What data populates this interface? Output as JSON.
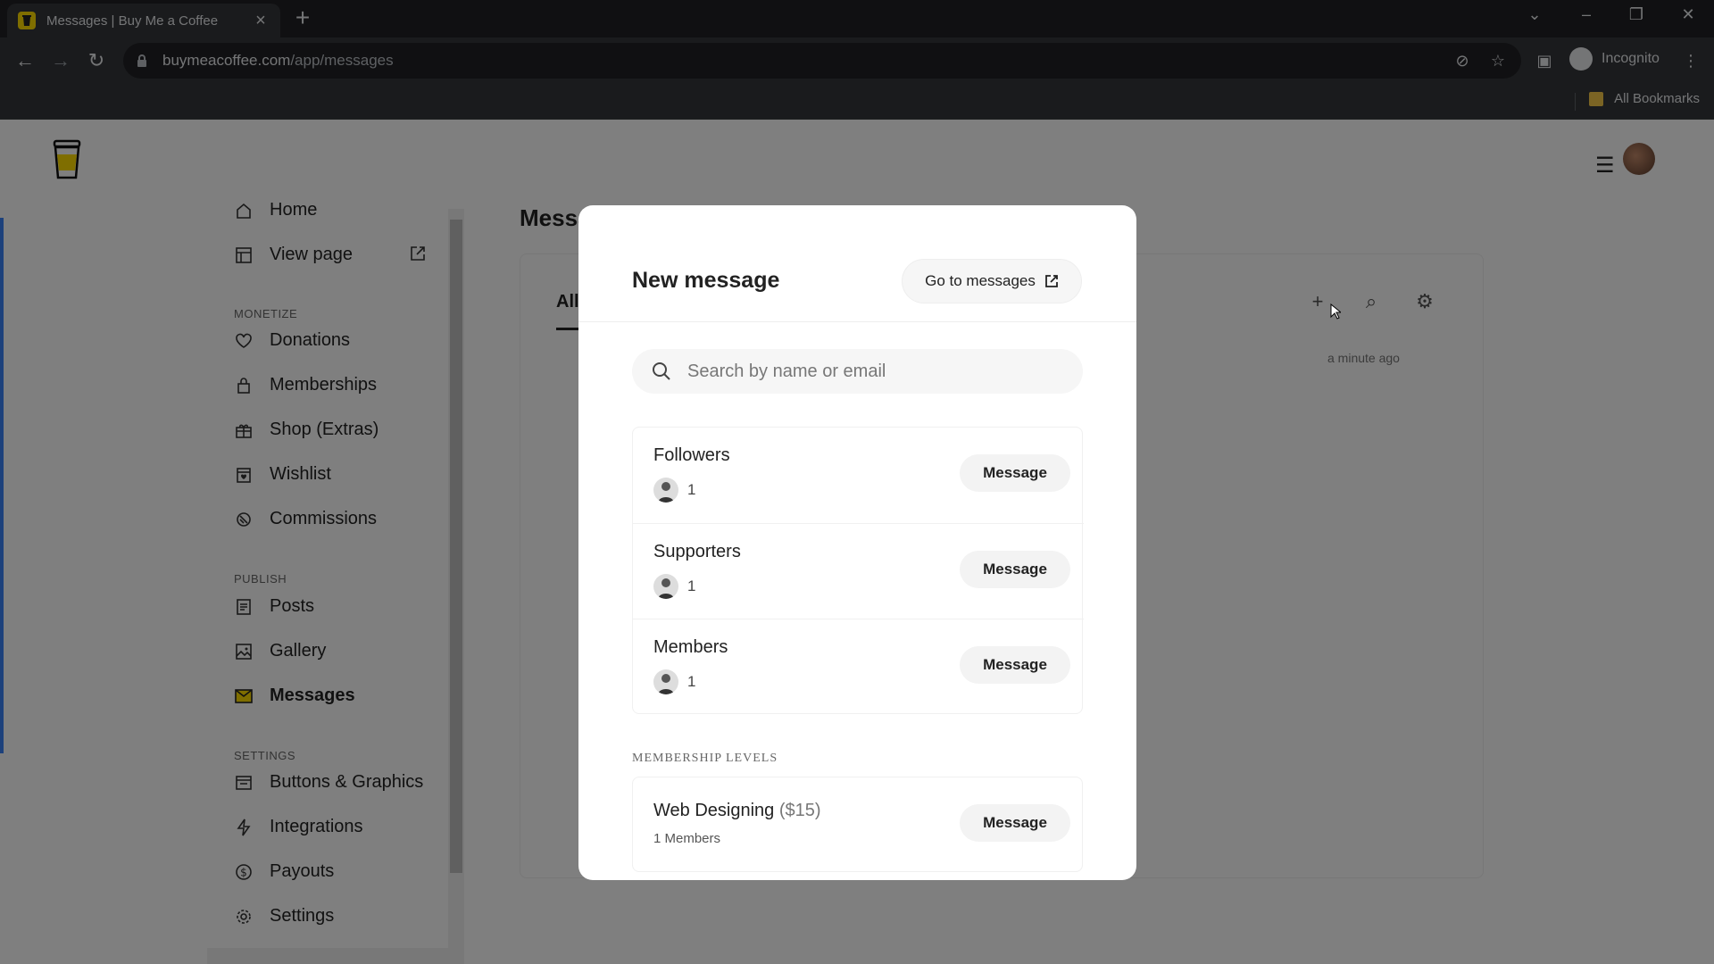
{
  "browser": {
    "tab_title": "Messages | Buy Me a Coffee",
    "url_host": "buymeacoffee.com",
    "url_path": "/app/messages",
    "profile_label": "Incognito",
    "bookmarks_label": "All Bookmarks"
  },
  "sidebar": {
    "items_top": [
      {
        "label": "Home",
        "icon": "home-icon"
      },
      {
        "label": "View page",
        "icon": "layout-icon"
      }
    ],
    "sections": [
      {
        "title": "MONETIZE",
        "items": [
          "Donations",
          "Memberships",
          "Shop (Extras)",
          "Wishlist",
          "Commissions"
        ]
      },
      {
        "title": "PUBLISH",
        "items": [
          "Posts",
          "Gallery",
          "Messages"
        ]
      },
      {
        "title": "SETTINGS",
        "items": [
          "Buttons & Graphics",
          "Integrations",
          "Payouts",
          "Settings"
        ]
      }
    ],
    "active": "Messages"
  },
  "main": {
    "title": "Messa",
    "tab_all": "All",
    "time": "a minute ago"
  },
  "modal": {
    "title": "New message",
    "go_label": "Go to messages",
    "search_placeholder": "Search by name or email",
    "groups": [
      {
        "name": "Followers",
        "count": "1",
        "button": "Message"
      },
      {
        "name": "Supporters",
        "count": "1",
        "button": "Message"
      },
      {
        "name": "Members",
        "count": "1",
        "button": "Message"
      }
    ],
    "levels_header": "MEMBERSHIP LEVELS",
    "levels": [
      {
        "name": "Web Designing",
        "price": "($15)",
        "sub": "1 Members",
        "button": "Message"
      }
    ]
  },
  "colors": {
    "brand_yellow": "#ffdd00",
    "accent_blue": "#3b82f6",
    "overlay": "rgba(0,0,0,0.5)"
  }
}
